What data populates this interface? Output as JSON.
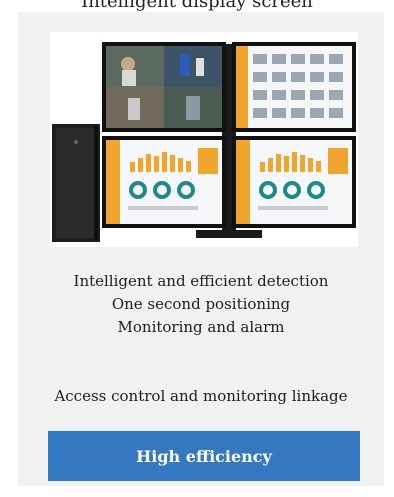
{
  "header": {
    "caption": "Intelligent display screen"
  },
  "card": {
    "image": {
      "alt": "Workstation with quad monitors showing video surveillance and monitoring dashboards"
    },
    "lines": [
      "Intelligent and efficient detection",
      "One second positioning",
      "Monitoring and alarm"
    ],
    "extra_line": "Access control and monitoring linkage",
    "cta_label": "High efficiency"
  },
  "colors": {
    "card_bg": "#f1f1f1",
    "cta_bg": "#3478c1",
    "cta_text": "#ffffff",
    "dashboard_orange": "#f0a52d"
  }
}
